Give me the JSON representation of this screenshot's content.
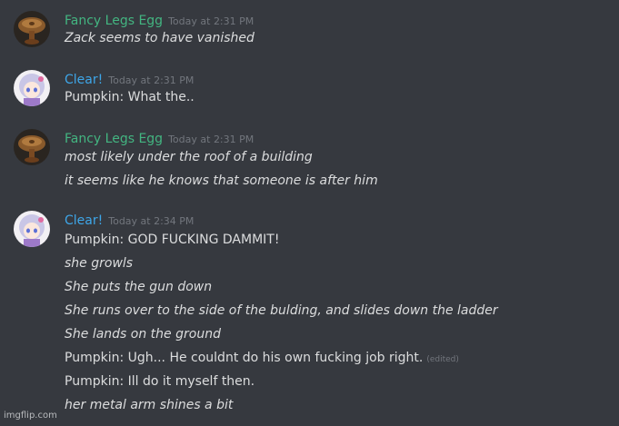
{
  "colors": {
    "egg_name": "#43b581",
    "clear_name": "#3ea6e8",
    "background": "#36393f"
  },
  "groups": [
    {
      "username": "Fancy Legs Egg",
      "avatar_icon": "egg-wood-avatar",
      "timestamp": "Today at 2:31 PM",
      "lines": [
        {
          "text": "Zack seems to have vanished",
          "italic": true
        }
      ]
    },
    {
      "username": "Clear!",
      "avatar_icon": "anime-character-avatar",
      "timestamp": "Today at 2:31 PM",
      "lines": [
        {
          "text": "Pumpkin: What the..",
          "italic": false
        }
      ]
    },
    {
      "username": "Fancy Legs Egg",
      "avatar_icon": "egg-wood-avatar",
      "timestamp": "Today at 2:31 PM",
      "lines": [
        {
          "text": "most likely under the roof of a building",
          "italic": true
        },
        {
          "text": "it seems like he knows that someone is after him",
          "italic": true
        }
      ]
    },
    {
      "username": "Clear!",
      "avatar_icon": "anime-character-avatar",
      "timestamp": "Today at 2:34 PM",
      "lines": [
        {
          "text": "Pumpkin: GOD FUCKING DAMMIT!",
          "italic": false
        },
        {
          "text": "she growls",
          "italic": true
        },
        {
          "text": "She puts the gun down",
          "italic": true
        },
        {
          "text": "She runs over to the side of the bulding, and slides down the ladder",
          "italic": true
        },
        {
          "text": "She lands on the ground",
          "italic": true
        },
        {
          "text": "Pumpkin: Ugh... He couldnt do his own fucking job right.",
          "italic": false,
          "edited": "(edited)"
        },
        {
          "text": "Pumpkin: Ill do it myself then.",
          "italic": false
        },
        {
          "text": "her metal arm shines a bit",
          "italic": true
        }
      ]
    }
  ],
  "watermark": "imgflip.com"
}
